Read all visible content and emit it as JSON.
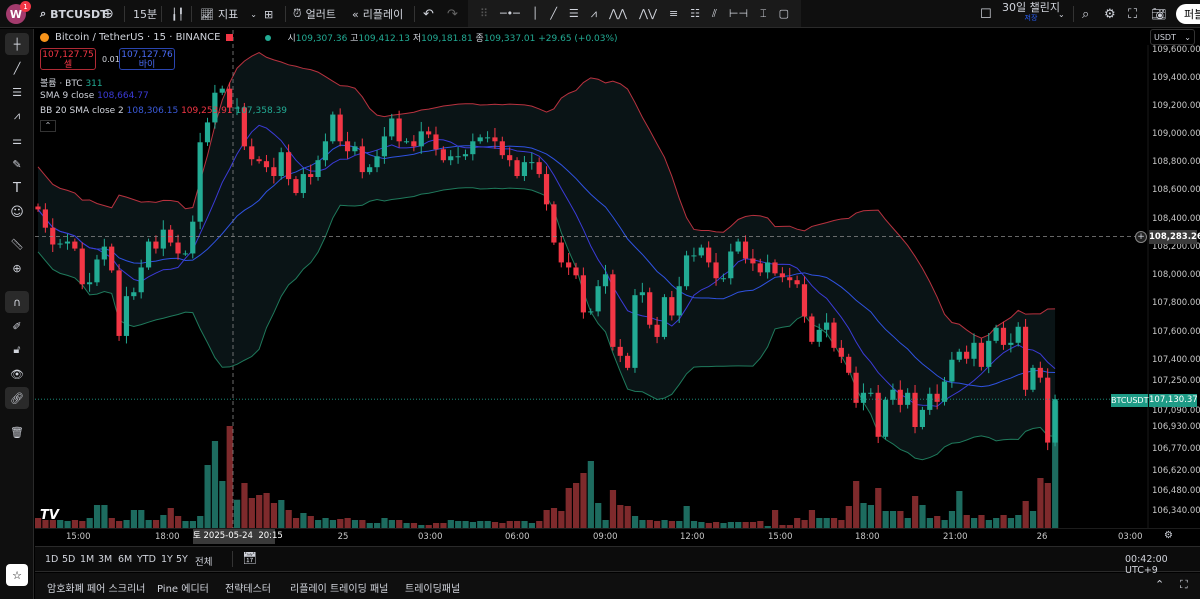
{
  "toolbar": {
    "avatar_letter": "W",
    "avatar_badge": "1",
    "symbol": "BTCUSDT",
    "interval": "15분",
    "indicators_label": "지표",
    "alert_label": "얼러트",
    "replay_label": "리플레이",
    "layout_name": "30일 챌린지",
    "layout_sub": "저장",
    "publish_label": "퍼블"
  },
  "legend": {
    "title": "Bitcoin / TetherUS · 15 · BINANCE",
    "ohlc": {
      "o_label": "시",
      "o": "109,307.36",
      "h_label": "고",
      "h": "109,412.13",
      "l_label": "저",
      "l": "109,181.81",
      "c_label": "종",
      "c": "109,337.01",
      "change": "+29.65 (+0.03%)"
    },
    "sell_price": "107,127.75",
    "sell_label": "셀",
    "spread": "0.01",
    "buy_price": "107,127.76",
    "buy_label": "바이",
    "volume_label": "볼륨 · BTC",
    "volume_value": "311",
    "sma_label": "SMA 9 close",
    "sma_value": "108,664.77",
    "bb_label": "BB 20 SMA close 2",
    "bb_basis": "108,306.15",
    "bb_upper": "109,253.91",
    "bb_lower": "107,358.39"
  },
  "price_axis": {
    "currency": "USDT",
    "ticks": [
      "109,600.00",
      "109,400.00",
      "109,200.00",
      "109,000.00",
      "108,800.00",
      "108,600.00",
      "108,400.00",
      "108,200.00",
      "108,000.00",
      "107,800.00",
      "107,600.00",
      "107,400.00",
      "107,250.00",
      "107,090.00",
      "106,930.00",
      "106,770.00",
      "106,620.00",
      "106,480.00",
      "106,340.00"
    ],
    "tick_values": [
      109600,
      109400,
      109200,
      109000,
      108800,
      108600,
      108400,
      108200,
      108000,
      107800,
      107600,
      107400,
      107250,
      107090,
      106930,
      106770,
      106620,
      106480,
      106340
    ],
    "crosshair_price": "108,283.26",
    "crosshair_value": 108283.26,
    "last_symbol": "BTCUSDT",
    "last_price": "107,130.37",
    "last_value": 107130.37
  },
  "time_axis": {
    "ticks": [
      "15:00",
      "18:00",
      "25",
      "03:00",
      "06:00",
      "09:00",
      "12:00",
      "15:00",
      "18:00",
      "21:00",
      "26",
      "03:00"
    ],
    "crosshair_time": "토 2025-05-24",
    "crosshair_clock": "20:15"
  },
  "range_bar": {
    "ranges": [
      "1D",
      "5D",
      "1M",
      "3M",
      "6M",
      "YTD",
      "1Y",
      "5Y",
      "전체"
    ],
    "clock": "00:42:00 UTC+9"
  },
  "bottom_tabs": [
    "암호화폐 페어 스크리너",
    "Pine 에디터",
    "전략테스터",
    "리플레이 트레이딩 패널",
    "트레이딩패널"
  ],
  "colors": {
    "up": "#22ab94",
    "down": "#f23645",
    "sma": "#3b3bd6",
    "bb_basis": "#2f52e0",
    "bb_upper": "#b8323f",
    "bb_lower": "#1f7a5c",
    "volume_up": "#1d6b5f",
    "volume_down": "#7e2a2c"
  },
  "chart_data": {
    "type": "candlestick",
    "interval": "15m",
    "closes": [
      108473,
      108345,
      108225,
      108232,
      108246,
      108196,
      107941,
      107955,
      108118,
      108210,
      108040,
      107579,
      107856,
      107884,
      108061,
      108246,
      108196,
      108331,
      108239,
      108161,
      108161,
      108388,
      108948,
      109090,
      109302,
      109331,
      109196,
      109196,
      108919,
      108827,
      108813,
      108770,
      108707,
      108877,
      108685,
      108586,
      108721,
      108700,
      108820,
      108955,
      109146,
      108955,
      108884,
      108919,
      108735,
      108770,
      108848,
      108990,
      109118,
      108955,
      108955,
      108919,
      109026,
      109004,
      108898,
      108820,
      108848,
      108848,
      108863,
      108955,
      108983,
      108983,
      108955,
      108856,
      108820,
      108707,
      108806,
      108806,
      108721,
      108508,
      108239,
      108097,
      108061,
      108005,
      107742,
      107749,
      107927,
      108012,
      107501,
      107437,
      107351,
      107863,
      107884,
      107657,
      107572,
      107849,
      107721,
      107927,
      108147,
      108147,
      108203,
      108097,
      107984,
      107984,
      108175,
      108246,
      108125,
      108090,
      108026,
      108097,
      108019,
      107991,
      107970,
      107941,
      107714,
      107537,
      107622,
      107672,
      107494,
      107430,
      107316,
      107105,
      107175,
      107175,
      106866,
      107126,
      107196,
      107091,
      107175,
      106937,
      107056,
      107168,
      107112,
      107253,
      107409,
      107466,
      107416,
      107530,
      107358,
      107544,
      107636,
      107515,
      107530,
      107643,
      107196,
      107351,
      107281,
      106824,
      107130.37
    ],
    "volumes": [
      110,
      88,
      88,
      88,
      77,
      88,
      77,
      110,
      253,
      253,
      110,
      77,
      88,
      198,
      198,
      88,
      88,
      143,
      220,
      132,
      77,
      77,
      132,
      693,
      957,
      517,
      1122,
      311,
      495,
      330,
      363,
      385,
      275,
      308,
      198,
      110,
      165,
      132,
      88,
      110,
      88,
      99,
      110,
      88,
      88,
      55,
      55,
      110,
      88,
      88,
      55,
      55,
      33,
      33,
      55,
      55,
      88,
      77,
      77,
      66,
      77,
      77,
      66,
      55,
      77,
      77,
      77,
      55,
      77,
      198,
      220,
      187,
      440,
      495,
      605,
      737,
      275,
      88,
      418,
      253,
      242,
      132,
      88,
      88,
      77,
      88,
      77,
      77,
      242,
      77,
      66,
      55,
      66,
      55,
      66,
      66,
      66,
      66,
      77,
      22,
      198,
      33,
      33,
      110,
      88,
      198,
      110,
      110,
      110,
      88,
      242,
      517,
      275,
      253,
      440,
      187,
      187,
      187,
      110,
      352,
      253,
      110,
      132,
      88,
      187,
      407,
      143,
      110,
      143,
      88,
      110,
      143,
      110,
      143,
      297,
      187,
      550,
      495,
      1397
    ],
    "indicators": [
      "SMA 9 close",
      "BB 20 SMA close 2",
      "Volume"
    ]
  }
}
